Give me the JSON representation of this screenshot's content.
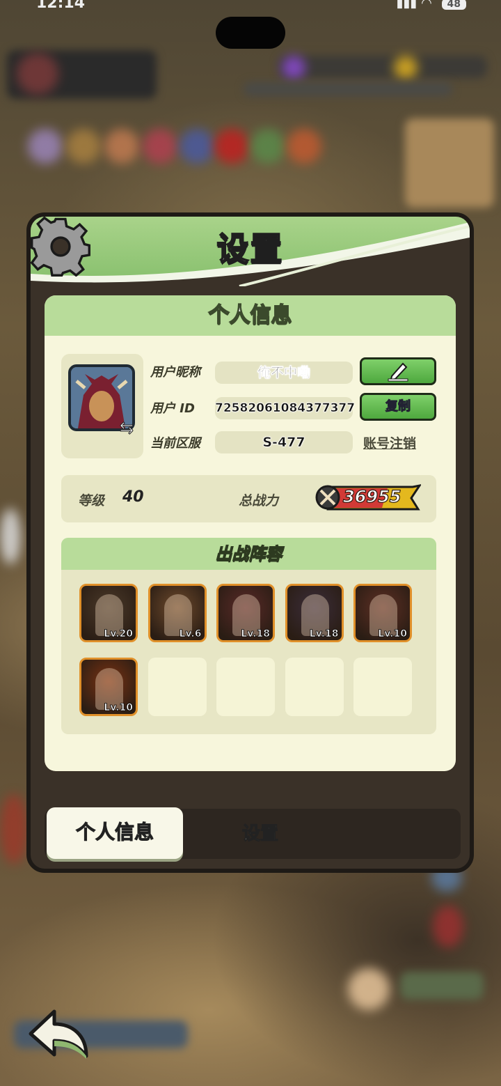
{
  "status": {
    "time": "12:14",
    "battery": "48"
  },
  "panel": {
    "title": "设置"
  },
  "profile": {
    "section_title": "个人信息",
    "nickname_label": "用户昵称",
    "nickname": "俺不中嘞",
    "id_label": "用户 ID",
    "user_id": "72582061084377377",
    "copy_button": "复制",
    "server_label": "当前区服",
    "server": "S-477",
    "cancel_account_link": "账号注销",
    "edit_icon": "pencil-icon",
    "swap_icon": "swap-icon"
  },
  "stats": {
    "level_label": "等级",
    "level": "40",
    "power_label": "总战力",
    "power": "36955"
  },
  "team": {
    "title": "出战阵容",
    "heroes": [
      {
        "name": "hero-dark-sage",
        "level": "Lv.20",
        "color": "#4b3a2a"
      },
      {
        "name": "hero-bard",
        "level": "Lv.6",
        "color": "#6e4a2c"
      },
      {
        "name": "hero-minotaur",
        "level": "Lv.18",
        "color": "#5a2a28"
      },
      {
        "name": "hero-witch",
        "level": "Lv.18",
        "color": "#3b2d3a"
      },
      {
        "name": "hero-red-hair",
        "level": "Lv.10",
        "color": "#5e2f24"
      },
      {
        "name": "hero-fire-demon",
        "level": "Lv.10",
        "color": "#7a3212"
      }
    ],
    "empty_slots": 4
  },
  "tabs": {
    "active": "个人信息",
    "inactive": "设置"
  }
}
